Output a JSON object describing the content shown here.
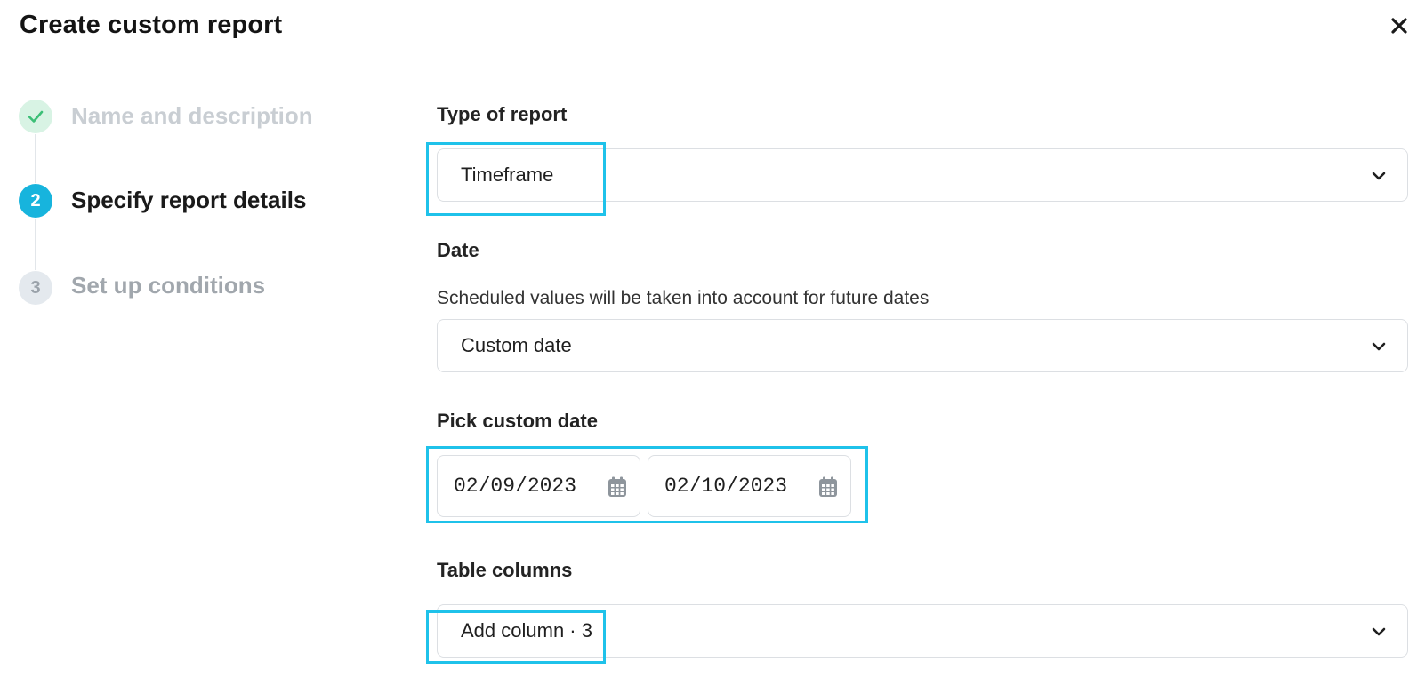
{
  "dialog": {
    "title": "Create custom report",
    "close_icon": "close-icon"
  },
  "stepper": {
    "steps": [
      {
        "marker": "check-icon",
        "label": "Name and description",
        "state": "completed"
      },
      {
        "marker": "2",
        "label": "Specify report details",
        "state": "active"
      },
      {
        "marker": "3",
        "label": "Set up conditions",
        "state": "upcoming"
      }
    ]
  },
  "form": {
    "report_type": {
      "label": "Type of report",
      "value": "Timeframe"
    },
    "date": {
      "label": "Date",
      "hint": "Scheduled values will be taken into account for future dates",
      "value": "Custom date"
    },
    "custom_date": {
      "label": "Pick custom date",
      "start": "02/09/2023",
      "end": "02/10/2023"
    },
    "table_columns": {
      "label": "Table columns",
      "value": "Add column · 3"
    }
  },
  "colors": {
    "accent": "#17b4dd",
    "highlight": "#1fc2ea",
    "done_bg": "#d8f3e4",
    "done_check": "#3cbf77"
  }
}
